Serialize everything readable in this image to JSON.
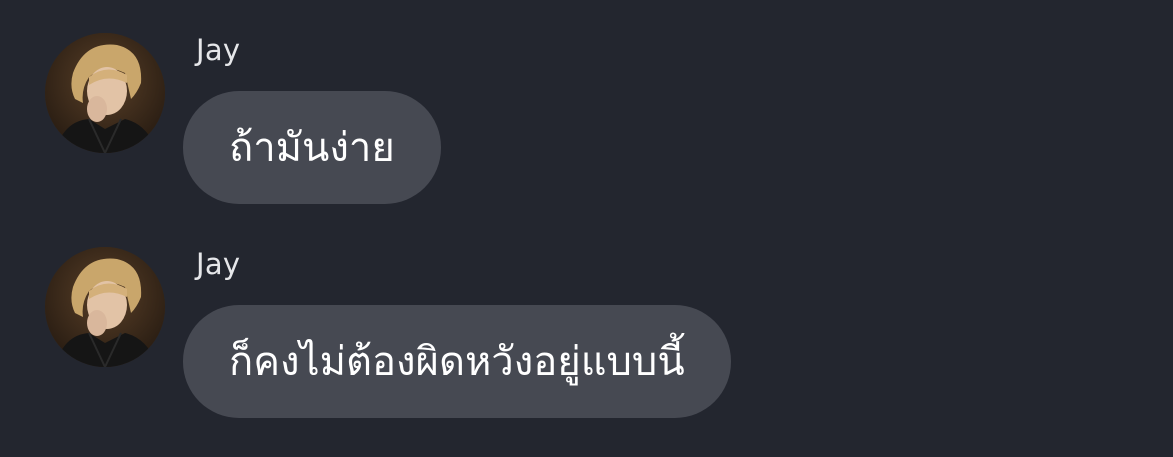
{
  "conversation": {
    "messages": [
      {
        "sender": "Jay",
        "text": "ถ้ามันง่าย",
        "avatar_icon": "user-avatar-photo"
      },
      {
        "sender": "Jay",
        "text": "ก็คงไม่ต้องผิดหวังอยู่แบบนี้",
        "avatar_icon": "user-avatar-photo"
      }
    ]
  },
  "colors": {
    "background": "#23262f",
    "bubble": "#464952",
    "sender_name": "#e6e7ea",
    "message_text": "#ffffff"
  }
}
